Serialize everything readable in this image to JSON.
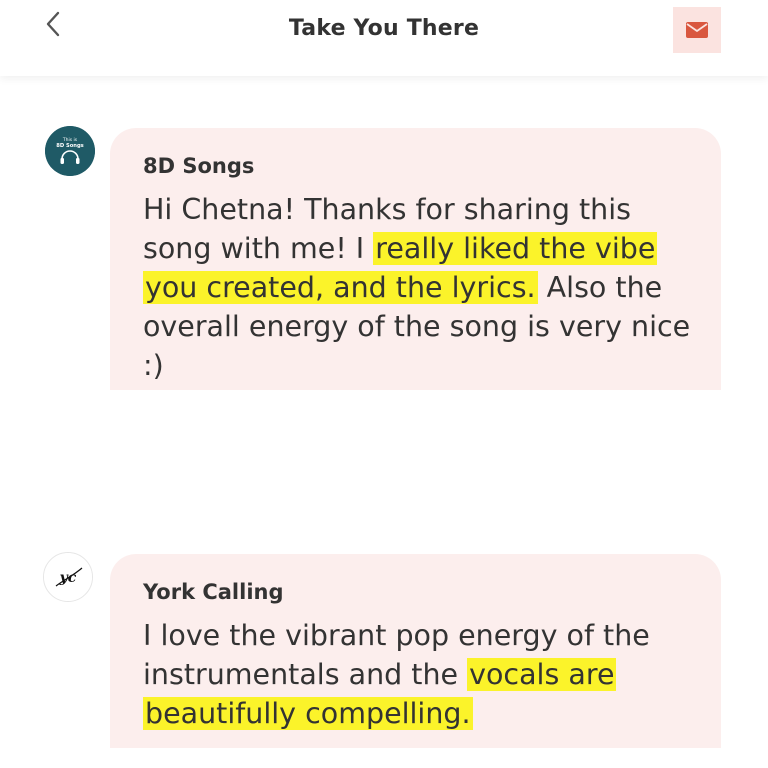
{
  "header": {
    "title": "Take You There",
    "back_icon": "chevron-left-icon",
    "mail_icon": "envelope-icon",
    "accent": "#d9573f",
    "mail_bg": "#fbe3e0"
  },
  "messages": [
    {
      "sender": "8D Songs",
      "avatar_text_top": "This is",
      "avatar_text_bottom": "8D Songs",
      "text_before": "Hi Chetna! Thanks for sharing this song with me! I ",
      "text_highlight": "really liked the vibe you created, and the lyrics.",
      "text_after": " Also the overall energy of the song is very nice :)"
    },
    {
      "sender": "York Calling",
      "avatar_text": "yc",
      "text_before": "I love the vibrant pop energy of the instrumentals and the ",
      "text_highlight": "vocals are beautifully compelling.",
      "text_after": ""
    }
  ],
  "colors": {
    "bubble_bg": "#fceeed",
    "highlight": "#fbf32a",
    "text": "#333333"
  }
}
